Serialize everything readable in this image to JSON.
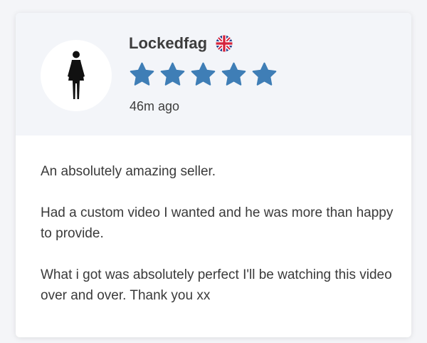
{
  "review": {
    "username": "Lockedfag",
    "country_flag_icon": "uk-flag-icon",
    "rating": 5,
    "rating_max": 5,
    "star_color": "#3f7eb6",
    "time_ago": "46m ago",
    "avatar_icon": "female-silhouette-icon",
    "paragraphs": [
      "An absolutely amazing seller.",
      "Had a custom video I wanted and he was more than happy to provide.",
      "What i got was absolutely perfect I'll be watching this video over and over. Thank you xx"
    ]
  }
}
